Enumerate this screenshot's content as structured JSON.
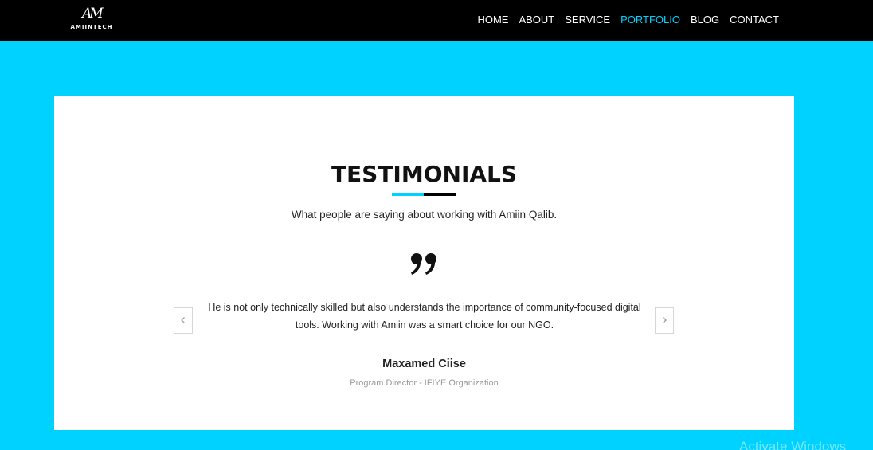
{
  "brand": {
    "mark": "AM",
    "name": "AMIINTECH"
  },
  "nav": {
    "items": [
      {
        "label": "HOME",
        "active": false
      },
      {
        "label": "ABOUT",
        "active": false
      },
      {
        "label": "SERVICE",
        "active": false
      },
      {
        "label": "PORTFOLIO",
        "active": true
      },
      {
        "label": "BLOG",
        "active": false
      },
      {
        "label": "CONTACT",
        "active": false
      }
    ]
  },
  "testimonials": {
    "title": "TESTIMONIALS",
    "subtitle": "What people are saying about working with Amiin Qalib.",
    "quote": "He is not only technically skilled but also understands the importance of community-focused digital tools. Working with Amiin was a smart choice for our NGO.",
    "author": "Maxamed Ciise",
    "role": "Program Director - IFIYE Organization",
    "prev_icon": "chevron-left-icon",
    "next_icon": "chevron-right-icon",
    "quote_icon": "quote-icon"
  },
  "watermark": "Activate Windows",
  "colors": {
    "accent": "#00d2ff",
    "navbar": "#000000",
    "card": "#ffffff"
  }
}
